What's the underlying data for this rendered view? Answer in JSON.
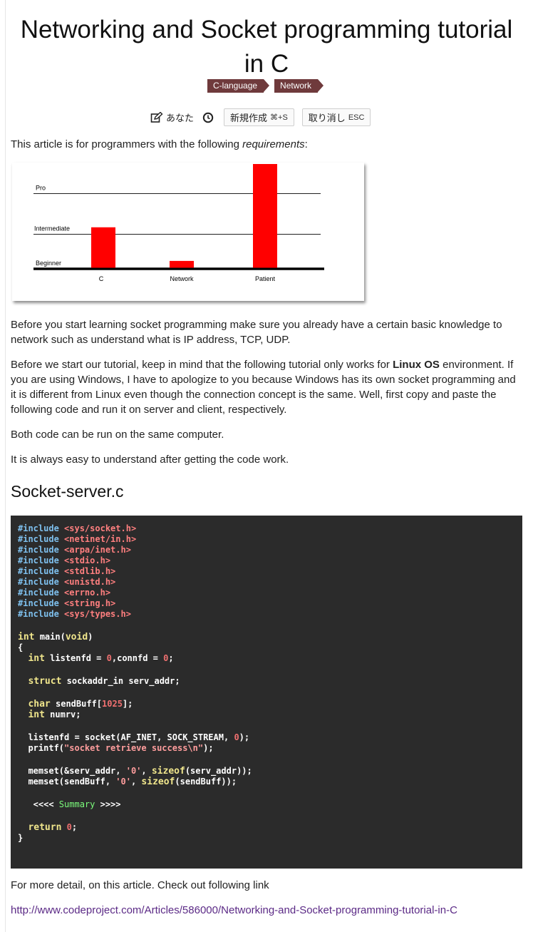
{
  "article": {
    "title": "Networking and Socket programming tutorial in C",
    "tags": [
      "C-language",
      "Network"
    ],
    "toolbar": {
      "author": "あなた",
      "new_label": "新規作成",
      "new_shortcut": "⌘+S",
      "undo_label": "取り消し",
      "undo_shortcut": "ESC"
    },
    "intro_prefix": "This article is for programmers with the following ",
    "intro_em": "requirements",
    "intro_suffix": ":",
    "para1": "Before you start learning socket programming make sure you already have a certain basic knowledge to network such as understand what is IP address, TCP, UDP.",
    "para2_prefix": "Before we start our tutorial, keep in mind that the following tutorial only works for ",
    "para2_bold": "Linux OS",
    "para2_suffix": " environment. If you are using Windows, I have to apologize to you because Windows has its own socket programming and it is different from Linux even though the connection concept is the same. Well, first copy and paste the following code and run it on server and client, respectively.",
    "para3": "Both code can be run on the same computer.",
    "para4": "It is always easy to understand after getting the code work.",
    "subheading": "Socket-server.c",
    "more_text": "For more detail, on this article. Check out following link",
    "link_url": "http://www.codeproject.com/Articles/586000/Networking-and-Socket-programming-tutorial-in-C"
  },
  "code": {
    "includes": [
      "<sys/socket.h>",
      "<netinet/in.h>",
      "<arpa/inet.h>",
      "<stdio.h>",
      "<stdlib.h>",
      "<unistd.h>",
      "<errno.h>",
      "<string.h>",
      "<sys/types.h>"
    ],
    "include_kw": "#include",
    "summary": "Summary"
  },
  "chart_data": {
    "type": "bar",
    "categories": [
      "C",
      "Network",
      "Patient"
    ],
    "values": [
      2.1,
      0.4,
      5.3
    ],
    "levels": [
      {
        "label": "Beginner",
        "value": 0
      },
      {
        "label": "Intermediate",
        "value": 1.75
      },
      {
        "label": "Pro",
        "value": 3.8
      }
    ],
    "ylim": [
      0,
      5.3
    ],
    "bar_color": "#ff0000"
  }
}
